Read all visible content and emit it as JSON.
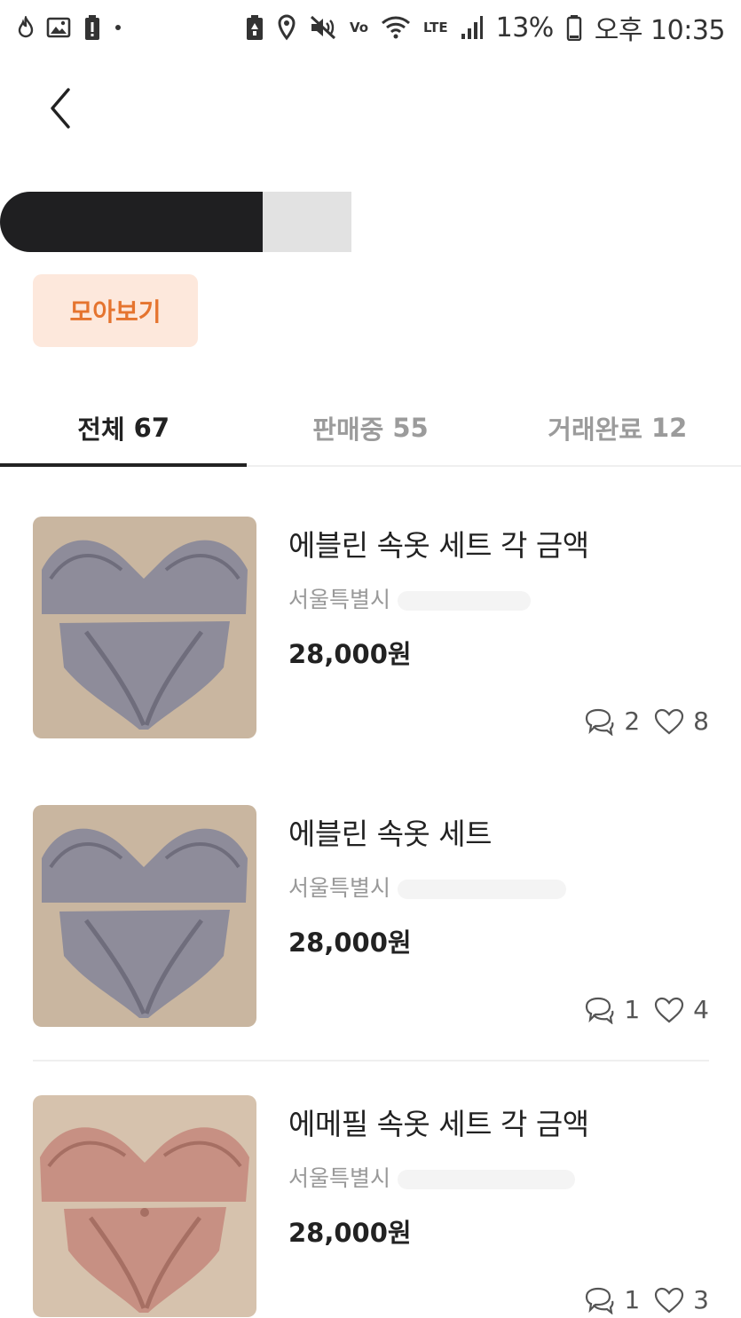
{
  "status_bar": {
    "battery_percent": "13%",
    "time": "오후 10:35",
    "volte": "Vo",
    "lte": "LTE",
    "icons": [
      "flame-icon",
      "image-icon",
      "battery-alert-icon",
      "dot-icon",
      "battery-saver-icon",
      "location-pin-icon",
      "mute-icon",
      "wifi-icon",
      "signal-icon",
      "battery-icon"
    ]
  },
  "header": {
    "back_icon": "chevron-left-icon"
  },
  "profile": {
    "collect_button_label": "모아보기"
  },
  "tabs": [
    {
      "label": "전체",
      "count": "67",
      "active": true
    },
    {
      "label": "판매중",
      "count": "55",
      "active": false
    },
    {
      "label": "거래완료",
      "count": "12",
      "active": false
    }
  ],
  "items": [
    {
      "title": "에블린 속옷 세트 각 금액",
      "location": "서울특별시",
      "price": "28,000원",
      "comments": "2",
      "likes": "8",
      "image_color": "#8e8c9a"
    },
    {
      "title": "에블린 속옷 세트",
      "location": "서울특별시",
      "price": "28,000원",
      "comments": "1",
      "likes": "4",
      "image_color": "#8e8c9a"
    },
    {
      "title": "에메필 속옷 세트 각 금액",
      "location": "서울특별시",
      "price": "28,000원",
      "comments": "1",
      "likes": "3",
      "image_color": "#c79083"
    }
  ],
  "colors": {
    "accent": "#e5742f",
    "accent_bg": "#fde8dc",
    "muted": "#999999"
  }
}
